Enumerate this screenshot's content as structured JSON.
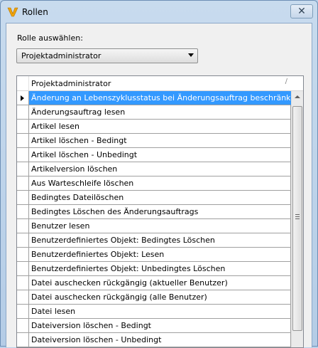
{
  "window": {
    "title": "Rollen",
    "close_glyph": "✕"
  },
  "role_selector": {
    "label": "Rolle auswählen:",
    "selected": "Projektadministrator"
  },
  "grid": {
    "column_header": "Projektadministrator",
    "sort_glyph": "/",
    "selected_row_index": 0,
    "rows": [
      "Änderung an Lebenszyklusstatus bei Änderungsauftrag beschränke...",
      "Änderungsauftrag lesen",
      "Artikel lesen",
      "Artikel löschen - Bedingt",
      "Artikel löschen - Unbedingt",
      "Artikelversion löschen",
      "Aus Warteschleife löschen",
      "Bedingtes Dateilöschen",
      "Bedingtes Löschen des Änderungsauftrags",
      "Benutzer lesen",
      "Benutzerdefiniertes Objekt: Bedingtes Löschen",
      "Benutzerdefiniertes Objekt: Lesen",
      "Benutzerdefiniertes Objekt: Unbedingtes Löschen",
      "Datei auschecken rückgängig (aktueller Benutzer)",
      "Datei auschecken rückgängig (alle Benutzer)",
      "Datei lesen",
      "Dateiversion löschen - Bedingt",
      "Dateiversion löschen - Unbedingt"
    ]
  },
  "colors": {
    "selection": "#3399ff",
    "brand_icon": "#f0a30a"
  },
  "icons": {
    "app": "vault-logo-icon",
    "close": "close-icon",
    "dropdown": "chevron-down-icon",
    "row_pointer": "current-row-arrow-icon"
  }
}
